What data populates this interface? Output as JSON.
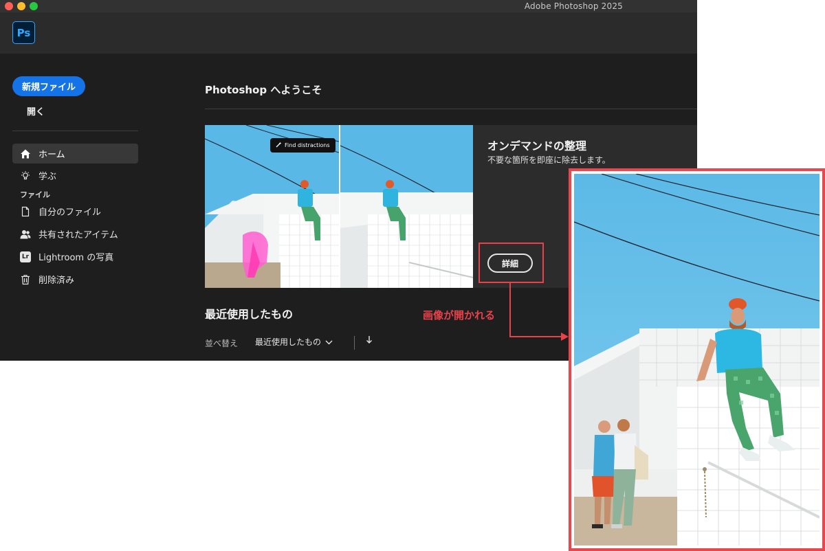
{
  "window": {
    "title": "Adobe Photoshop 2025"
  },
  "app": {
    "logo_text": "Ps"
  },
  "sidebar": {
    "new_file_label": "新規ファイル",
    "open_label": "開く",
    "items": [
      {
        "label": "ホーム",
        "icon": "home-icon",
        "active": true
      },
      {
        "label": "学ぶ",
        "icon": "lightbulb-icon",
        "active": false
      }
    ],
    "section_label": "ファイル",
    "file_items": [
      {
        "label": "自分のファイル",
        "icon": "document-icon"
      },
      {
        "label": "共有されたアイテム",
        "icon": "shared-user-icon"
      },
      {
        "label": "Lightroom の写真",
        "icon": "lightroom-icon",
        "badge": "Lr"
      },
      {
        "label": "削除済み",
        "icon": "trash-icon"
      }
    ]
  },
  "main": {
    "welcome_title": "Photoshop へようこそ",
    "promo": {
      "chip_label": "Find distractions",
      "title": "オンデマンドの整理",
      "description": "不要な箇所を即座に除去します。",
      "button_label": "詳細"
    },
    "recent": {
      "title": "最近使用したもの",
      "sort_label": "並べ替え",
      "sort_value": "最近使用したもの",
      "sort_direction_icon": "arrow-down-icon"
    }
  },
  "annotation": {
    "text": "画像が開かれる",
    "color": "#e8424b"
  },
  "colors": {
    "accent": "#1473e6",
    "app_bg": "#1e1e1e",
    "sky": "#5ab8e6"
  }
}
